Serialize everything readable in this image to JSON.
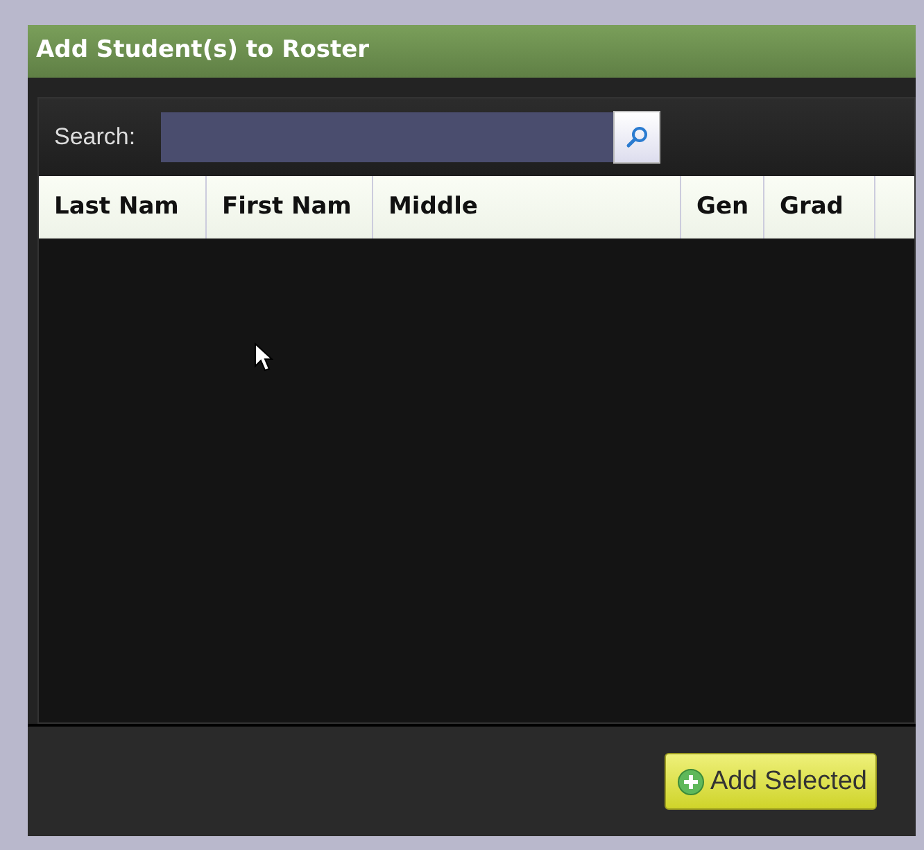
{
  "panel": {
    "title": "Add Student(s) to Roster"
  },
  "search": {
    "label": "Search:"
  },
  "table": {
    "columns": [
      "Last Nam",
      "First Nam",
      "Middle",
      "Gen",
      "Grad"
    ]
  },
  "buttons": [
    {
      "label": "Add Selected"
    }
  ]
}
